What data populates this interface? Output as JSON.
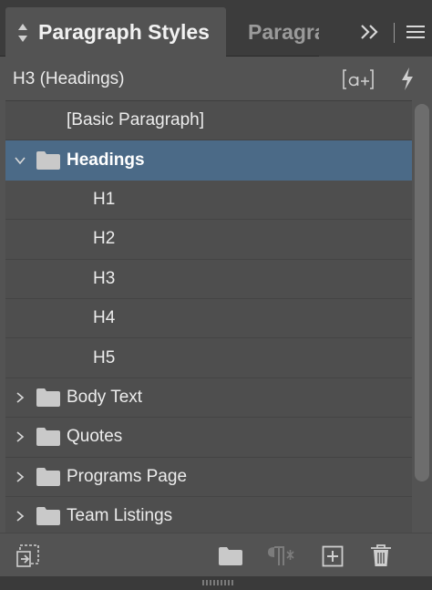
{
  "tabs": [
    {
      "label": "Paragraph Styles",
      "active": true
    },
    {
      "label": "Paragraph",
      "active": false
    }
  ],
  "header": {
    "current_style": "H3 (Headings)"
  },
  "styles": [
    {
      "label": "[Basic Paragraph]",
      "kind": "style",
      "level": 0
    },
    {
      "label": "Headings",
      "kind": "group",
      "expanded": true,
      "selected": true
    },
    {
      "label": "H1",
      "kind": "style",
      "level": 1
    },
    {
      "label": "H2",
      "kind": "style",
      "level": 1
    },
    {
      "label": "H3",
      "kind": "style",
      "level": 1
    },
    {
      "label": "H4",
      "kind": "style",
      "level": 1
    },
    {
      "label": "H5",
      "kind": "style",
      "level": 1
    },
    {
      "label": "Body Text",
      "kind": "group",
      "expanded": false
    },
    {
      "label": "Quotes",
      "kind": "group",
      "expanded": false
    },
    {
      "label": "Programs Page",
      "kind": "group",
      "expanded": false
    },
    {
      "label": "Team Listings",
      "kind": "group",
      "expanded": false
    }
  ],
  "colors": {
    "panel": "#535353",
    "selection": "#4b6a87",
    "text": "#ececec"
  },
  "icons": {
    "tab_diamond": "diamond-arrows-icon",
    "overflow": "double-chevron-right-icon",
    "menu": "hamburger-menu-icon",
    "override": "clear-overrides-icon",
    "quick_apply": "lightning-bolt-icon",
    "load_styles": "load-styles-icon",
    "new_group": "folder-icon",
    "clear_override": "pilcrow-clear-icon",
    "new_style": "new-style-icon",
    "delete": "trash-icon"
  }
}
